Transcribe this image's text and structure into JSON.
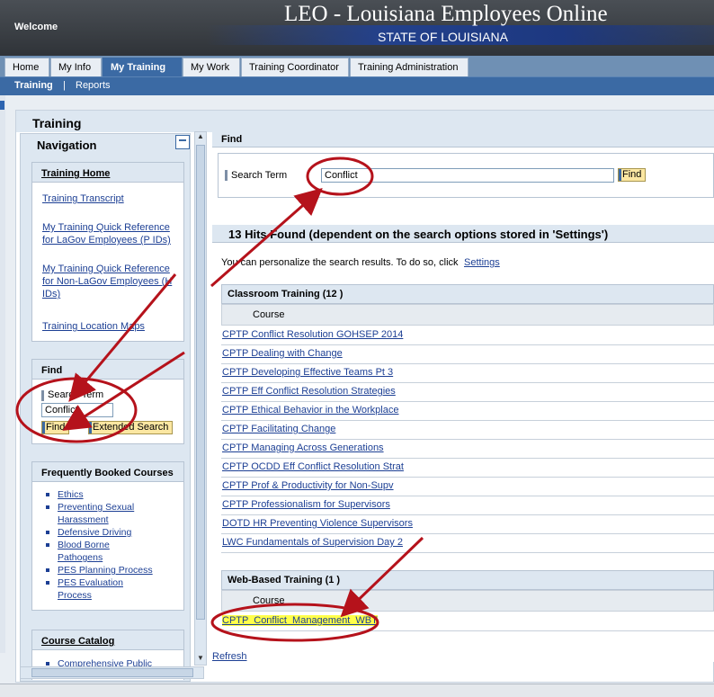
{
  "header": {
    "welcome": "Welcome",
    "title": "LEO - Louisiana Employees Online",
    "subtitle": "STATE OF LOUISIANA"
  },
  "tabs": [
    "Home",
    "My Info",
    "My Training",
    "My Work",
    "Training Coordinator",
    "Training Administration"
  ],
  "active_tab": "My Training",
  "subtabs": [
    "Training",
    "|",
    "Reports"
  ],
  "page_title": "Training",
  "navigation": {
    "title": "Navigation",
    "training_home": {
      "title": "Training Home",
      "links": [
        "Training Transcript",
        "My Training Quick Reference for LaGov Employees (P IDs)",
        "My Training Quick Reference for Non-LaGov Employees (H IDs)",
        "Training Location Maps"
      ]
    },
    "find": {
      "title": "Find",
      "search_label": "Search Term",
      "search_value": "Conflict",
      "find_button": "Find",
      "extended_button": "Extended Search"
    },
    "frequent": {
      "title": "Frequently Booked Courses",
      "items": [
        "Ethics",
        "Preventing Sexual Harassment",
        "Defensive Driving",
        "Blood Borne Pathogens",
        "PES Planning Process",
        "PES Evaluation Process"
      ]
    },
    "catalog": {
      "title": "Course Catalog",
      "items": [
        "Comprehensive Public"
      ]
    }
  },
  "find": {
    "title": "Find",
    "search_label": "Search Term",
    "search_value": "Conflict",
    "find_button": "Find"
  },
  "results": {
    "hits_title": "13 Hits Found (dependent on the search options stored in 'Settings')",
    "personalize_text": "You can personalize the search results. To do so, click",
    "settings_link": "Settings",
    "classroom": {
      "title": "Classroom Training (12 )",
      "column": "Course",
      "courses": [
        "CPTP Conflict Resolution GOHSEP 2014",
        "CPTP Dealing with Change",
        "CPTP Developing Effective Teams Pt 3",
        "CPTP Eff Conflict Resolution Strategies",
        "CPTP Ethical Behavior in the Workplace",
        "CPTP Facilitating Change",
        "CPTP Managing Across Generations",
        "CPTP OCDD Eff Conflict Resolution Strat",
        "CPTP Prof & Productivity for Non-Supv",
        "CPTP Professionalism for Supervisors",
        "DOTD HR Preventing Violence Supervisors",
        "LWC Fundamentals of Supervision Day 2"
      ]
    },
    "webbased": {
      "title": "Web-Based Training (1 )",
      "column": "Course",
      "courses": [
        "CPTP  Conflict  Management  WBT"
      ]
    },
    "refresh": "Refresh"
  },
  "colors": {
    "tab_active": "#3b6aa4",
    "annotation": "#b5121b",
    "highlight": "#ffff4a",
    "button": "#fbe7a2"
  }
}
